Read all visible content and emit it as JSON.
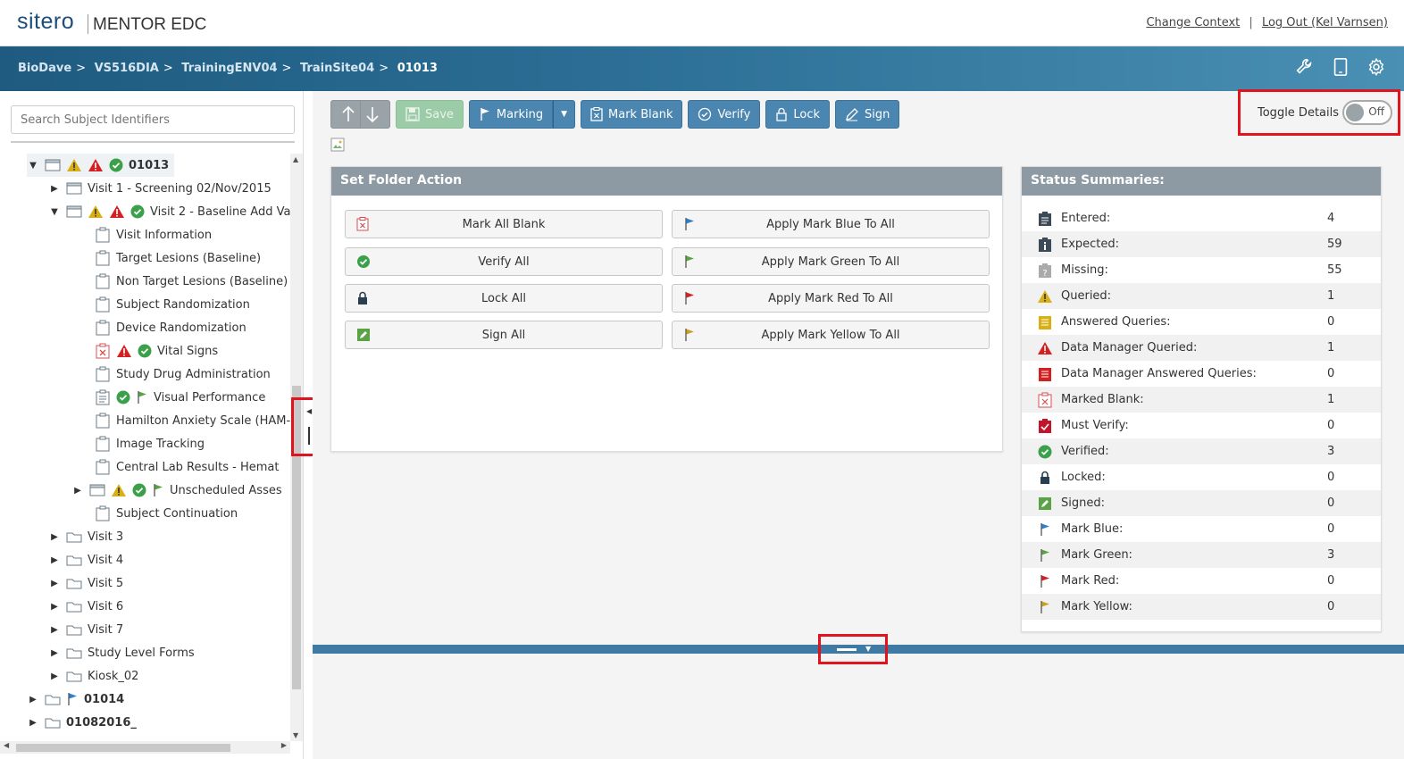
{
  "header": {
    "logo_text": "sitero",
    "product_name": "MENTOR EDC",
    "change_context": "Change Context",
    "separator": "|",
    "logout": "Log Out (Kel Varnsen)"
  },
  "breadcrumb": {
    "items": [
      "BioDave",
      "VS516DIA",
      "TrainingENV04",
      "TrainSite04"
    ],
    "current": "01013",
    "sep": ">"
  },
  "sidebar": {
    "search_placeholder": "Search Subject Identifiers",
    "tree": [
      {
        "label": "01013"
      },
      {
        "label": "Visit 1 - Screening 02/Nov/2015"
      },
      {
        "label": "Visit 2 - Baseline Add Va"
      },
      {
        "label": "Visit Information"
      },
      {
        "label": "Target Lesions (Baseline)"
      },
      {
        "label": "Non Target Lesions (Baseline)"
      },
      {
        "label": "Subject Randomization"
      },
      {
        "label": "Device Randomization"
      },
      {
        "label": "Vital Signs"
      },
      {
        "label": "Study Drug Administration"
      },
      {
        "label": "Visual Performance"
      },
      {
        "label": "Hamilton Anxiety Scale (HAM-A"
      },
      {
        "label": "Image Tracking"
      },
      {
        "label": "Central Lab Results - Hemat"
      },
      {
        "label": "Unscheduled Asses"
      },
      {
        "label": "Subject Continuation"
      },
      {
        "label": "Visit 3"
      },
      {
        "label": "Visit 4"
      },
      {
        "label": "Visit 5"
      },
      {
        "label": "Visit 6"
      },
      {
        "label": "Visit 7"
      },
      {
        "label": "Study Level Forms"
      },
      {
        "label": "Kiosk_02"
      },
      {
        "label": "01014"
      },
      {
        "label": "01082016_"
      }
    ]
  },
  "toolbar": {
    "save": "Save",
    "marking": "Marking",
    "mark_blank": "Mark Blank",
    "verify": "Verify",
    "lock": "Lock",
    "sign": "Sign",
    "toggle_label": "Toggle Details",
    "toggle_state": "Off"
  },
  "folder_action": {
    "title": "Set Folder Action",
    "left": [
      "Mark All Blank",
      "Verify All",
      "Lock All",
      "Sign All"
    ],
    "right": [
      "Apply Mark Blue To All",
      "Apply Mark Green To All",
      "Apply Mark Red To All",
      "Apply Mark Yellow To All"
    ]
  },
  "status_summaries": {
    "title": "Status Summaries:",
    "rows": [
      {
        "label": "Entered:",
        "value": "4"
      },
      {
        "label": "Expected:",
        "value": "59"
      },
      {
        "label": "Missing:",
        "value": "55"
      },
      {
        "label": "Queried:",
        "value": "1"
      },
      {
        "label": "Answered Queries:",
        "value": "0"
      },
      {
        "label": "Data Manager Queried:",
        "value": "1"
      },
      {
        "label": "Data Manager Answered Queries:",
        "value": "0"
      },
      {
        "label": "Marked Blank:",
        "value": "1"
      },
      {
        "label": "Must Verify:",
        "value": "0"
      },
      {
        "label": "Verified:",
        "value": "3"
      },
      {
        "label": "Locked:",
        "value": "0"
      },
      {
        "label": "Signed:",
        "value": "0"
      },
      {
        "label": "Mark Blue:",
        "value": "0"
      },
      {
        "label": "Mark Green:",
        "value": "3"
      },
      {
        "label": "Mark Red:",
        "value": "0"
      },
      {
        "label": "Mark Yellow:",
        "value": "0"
      }
    ]
  },
  "colors": {
    "nav_blue": "#2a6c93",
    "button_blue": "#4a86b0",
    "panel_header": "#8e9aa3",
    "highlight_red": "#e0141e",
    "ok_green": "#3aa14a",
    "warn_yellow": "#d8b015",
    "alert_red": "#d42020",
    "flag_blue": "#2f7fd0",
    "flag_green": "#5aa344",
    "flag_red": "#d42020",
    "flag_yellow": "#c9a11b"
  },
  "icons": {
    "navbar": [
      "wrench-icon",
      "tablet-icon",
      "gear-icon"
    ]
  }
}
